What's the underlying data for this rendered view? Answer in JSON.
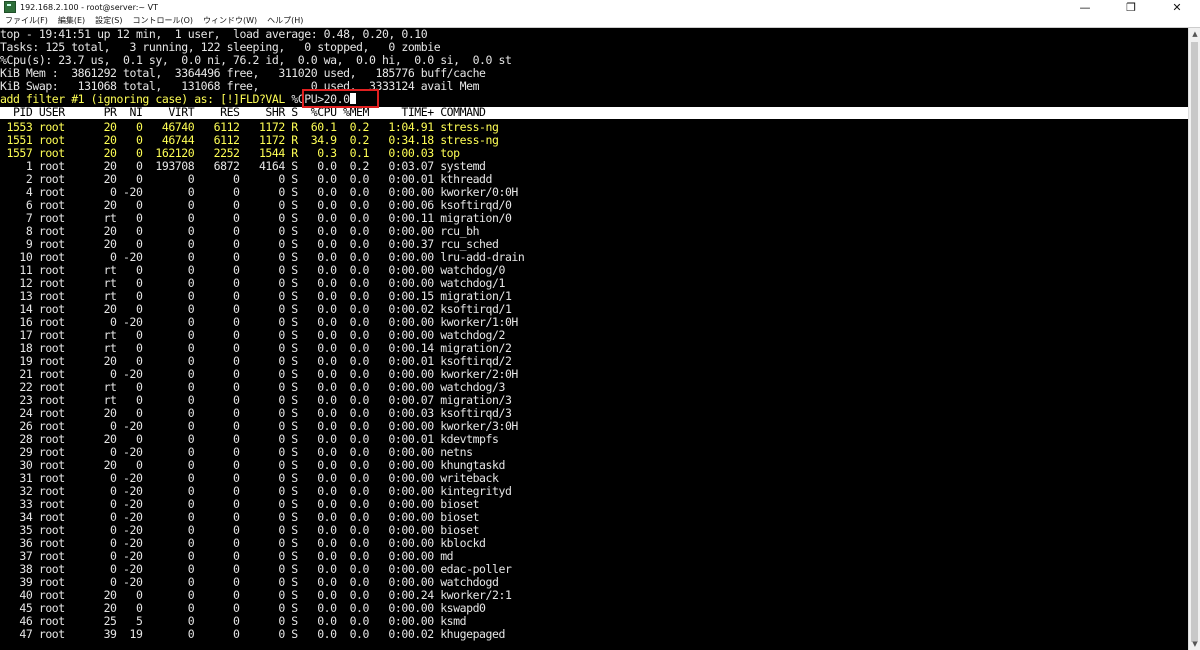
{
  "window": {
    "title": "192.168.2.100 - root@server:~ VT",
    "minimize_icon": "minimize-icon",
    "maximize_icon": "restore-icon",
    "close_icon": "close-icon"
  },
  "menu": [
    "ファイル(F)",
    "編集(E)",
    "設定(S)",
    "コントロール(O)",
    "ウィンドウ(W)",
    "ヘルプ(H)"
  ],
  "terminal": {
    "summary": [
      "top - 19:41:51 up 12 min,  1 user,  load average: 0.48, 0.20, 0.10",
      "Tasks: 125 total,   3 running, 122 sleeping,   0 stopped,   0 zombie",
      "%Cpu(s): 23.7 us,  0.1 sy,  0.0 ni, 76.2 id,  0.0 wa,  0.0 hi,  0.0 si,  0.0 st",
      "KiB Mem :  3861292 total,  3364496 free,   311020 used,   185776 buff/cache",
      "KiB Swap:   131068 total,   131068 free,        0 used.  3333124 avail Mem"
    ],
    "filter_prompt": "add filter #1 (ignoring case) as: [!]FLD?VAL ",
    "filter_value": "%CPU>20.0",
    "header": "  PID USER      PR  NI    VIRT    RES    SHR S  %CPU %MEM     TIME+ COMMAND",
    "processes": [
      {
        "line": " 1553 root      20   0   46740   6112   1172 R  60.1  0.2   1:04.91 stress-ng",
        "hl": true
      },
      {
        "line": " 1551 root      20   0   46744   6112   1172 R  34.9  0.2   0:34.18 stress-ng",
        "hl": true
      },
      {
        "line": " 1557 root      20   0  162120   2252   1544 R   0.3  0.1   0:00.03 top",
        "hl": true
      },
      {
        "line": "    1 root      20   0  193708   6872   4164 S   0.0  0.2   0:03.07 systemd",
        "hl": false
      },
      {
        "line": "    2 root      20   0       0      0      0 S   0.0  0.0   0:00.01 kthreadd",
        "hl": false
      },
      {
        "line": "    4 root       0 -20       0      0      0 S   0.0  0.0   0:00.00 kworker/0:0H",
        "hl": false
      },
      {
        "line": "    6 root      20   0       0      0      0 S   0.0  0.0   0:00.06 ksoftirqd/0",
        "hl": false
      },
      {
        "line": "    7 root      rt   0       0      0      0 S   0.0  0.0   0:00.11 migration/0",
        "hl": false
      },
      {
        "line": "    8 root      20   0       0      0      0 S   0.0  0.0   0:00.00 rcu_bh",
        "hl": false
      },
      {
        "line": "    9 root      20   0       0      0      0 S   0.0  0.0   0:00.37 rcu_sched",
        "hl": false
      },
      {
        "line": "   10 root       0 -20       0      0      0 S   0.0  0.0   0:00.00 lru-add-drain",
        "hl": false
      },
      {
        "line": "   11 root      rt   0       0      0      0 S   0.0  0.0   0:00.00 watchdog/0",
        "hl": false
      },
      {
        "line": "   12 root      rt   0       0      0      0 S   0.0  0.0   0:00.00 watchdog/1",
        "hl": false
      },
      {
        "line": "   13 root      rt   0       0      0      0 S   0.0  0.0   0:00.15 migration/1",
        "hl": false
      },
      {
        "line": "   14 root      20   0       0      0      0 S   0.0  0.0   0:00.02 ksoftirqd/1",
        "hl": false
      },
      {
        "line": "   16 root       0 -20       0      0      0 S   0.0  0.0   0:00.00 kworker/1:0H",
        "hl": false
      },
      {
        "line": "   17 root      rt   0       0      0      0 S   0.0  0.0   0:00.00 watchdog/2",
        "hl": false
      },
      {
        "line": "   18 root      rt   0       0      0      0 S   0.0  0.0   0:00.14 migration/2",
        "hl": false
      },
      {
        "line": "   19 root      20   0       0      0      0 S   0.0  0.0   0:00.01 ksoftirqd/2",
        "hl": false
      },
      {
        "line": "   21 root       0 -20       0      0      0 S   0.0  0.0   0:00.00 kworker/2:0H",
        "hl": false
      },
      {
        "line": "   22 root      rt   0       0      0      0 S   0.0  0.0   0:00.00 watchdog/3",
        "hl": false
      },
      {
        "line": "   23 root      rt   0       0      0      0 S   0.0  0.0   0:00.07 migration/3",
        "hl": false
      },
      {
        "line": "   24 root      20   0       0      0      0 S   0.0  0.0   0:00.03 ksoftirqd/3",
        "hl": false
      },
      {
        "line": "   26 root       0 -20       0      0      0 S   0.0  0.0   0:00.00 kworker/3:0H",
        "hl": false
      },
      {
        "line": "   28 root      20   0       0      0      0 S   0.0  0.0   0:00.01 kdevtmpfs",
        "hl": false
      },
      {
        "line": "   29 root       0 -20       0      0      0 S   0.0  0.0   0:00.00 netns",
        "hl": false
      },
      {
        "line": "   30 root      20   0       0      0      0 S   0.0  0.0   0:00.00 khungtaskd",
        "hl": false
      },
      {
        "line": "   31 root       0 -20       0      0      0 S   0.0  0.0   0:00.00 writeback",
        "hl": false
      },
      {
        "line": "   32 root       0 -20       0      0      0 S   0.0  0.0   0:00.00 kintegrityd",
        "hl": false
      },
      {
        "line": "   33 root       0 -20       0      0      0 S   0.0  0.0   0:00.00 bioset",
        "hl": false
      },
      {
        "line": "   34 root       0 -20       0      0      0 S   0.0  0.0   0:00.00 bioset",
        "hl": false
      },
      {
        "line": "   35 root       0 -20       0      0      0 S   0.0  0.0   0:00.00 bioset",
        "hl": false
      },
      {
        "line": "   36 root       0 -20       0      0      0 S   0.0  0.0   0:00.00 kblockd",
        "hl": false
      },
      {
        "line": "   37 root       0 -20       0      0      0 S   0.0  0.0   0:00.00 md",
        "hl": false
      },
      {
        "line": "   38 root       0 -20       0      0      0 S   0.0  0.0   0:00.00 edac-poller",
        "hl": false
      },
      {
        "line": "   39 root       0 -20       0      0      0 S   0.0  0.0   0:00.00 watchdogd",
        "hl": false
      },
      {
        "line": "   40 root      20   0       0      0      0 S   0.0  0.0   0:00.24 kworker/2:1",
        "hl": false
      },
      {
        "line": "   45 root      20   0       0      0      0 S   0.0  0.0   0:00.00 kswapd0",
        "hl": false
      },
      {
        "line": "   46 root      25   5       0      0      0 S   0.0  0.0   0:00.00 ksmd",
        "hl": false
      },
      {
        "line": "   47 root      39  19       0      0      0 S   0.0  0.0   0:00.02 khugepaged",
        "hl": false
      }
    ]
  }
}
